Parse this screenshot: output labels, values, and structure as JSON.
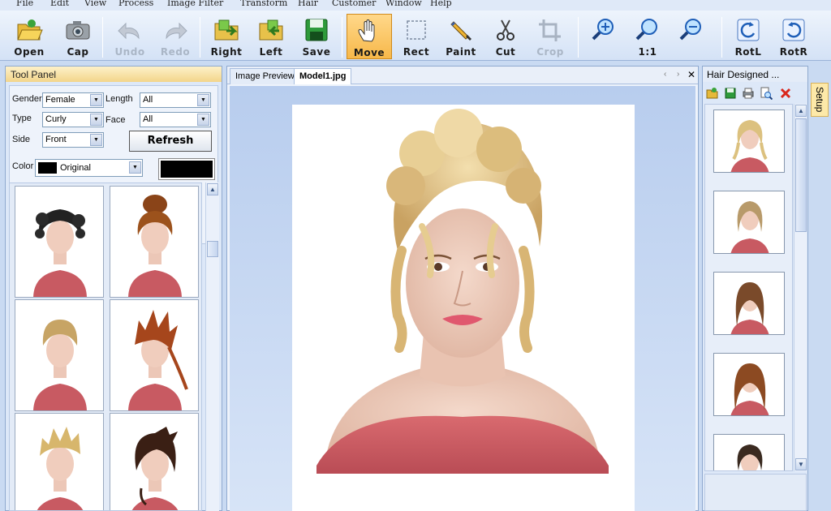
{
  "menu": [
    "File",
    "Edit",
    "View",
    "Process",
    "Image Filter",
    "Transform",
    "Hair",
    "Customer",
    "Window",
    "Help"
  ],
  "toolbar": {
    "open": "Open",
    "cap": "Cap",
    "undo": "Undo",
    "redo": "Redo",
    "right": "Right",
    "left": "Left",
    "save": "Save",
    "move": "Move",
    "rect": "Rect",
    "paint": "Paint",
    "cut": "Cut",
    "crop": "Crop",
    "zoom_actual": "1:1",
    "rotl": "RotL",
    "rotr": "RotR"
  },
  "tool_panel": {
    "title": "Tool Panel",
    "gender_label": "Gender",
    "gender_value": "Female",
    "length_label": "Length",
    "length_value": "All",
    "type_label": "Type",
    "type_value": "Curly",
    "face_label": "Face",
    "face_value": "All",
    "side_label": "Side",
    "side_value": "Front",
    "refresh_label": "Refresh",
    "color_label": "Color",
    "color_value": "Original",
    "color_hex": "#000000"
  },
  "document": {
    "tabs": [
      "Image Preview",
      "Model1.jpg"
    ],
    "active_tab": "Model1.jpg",
    "nav_prev": "‹",
    "nav_next": "›",
    "close": "✕"
  },
  "hair_panel": {
    "title": "Hair Designed ..."
  },
  "setup_tab": "Setup"
}
